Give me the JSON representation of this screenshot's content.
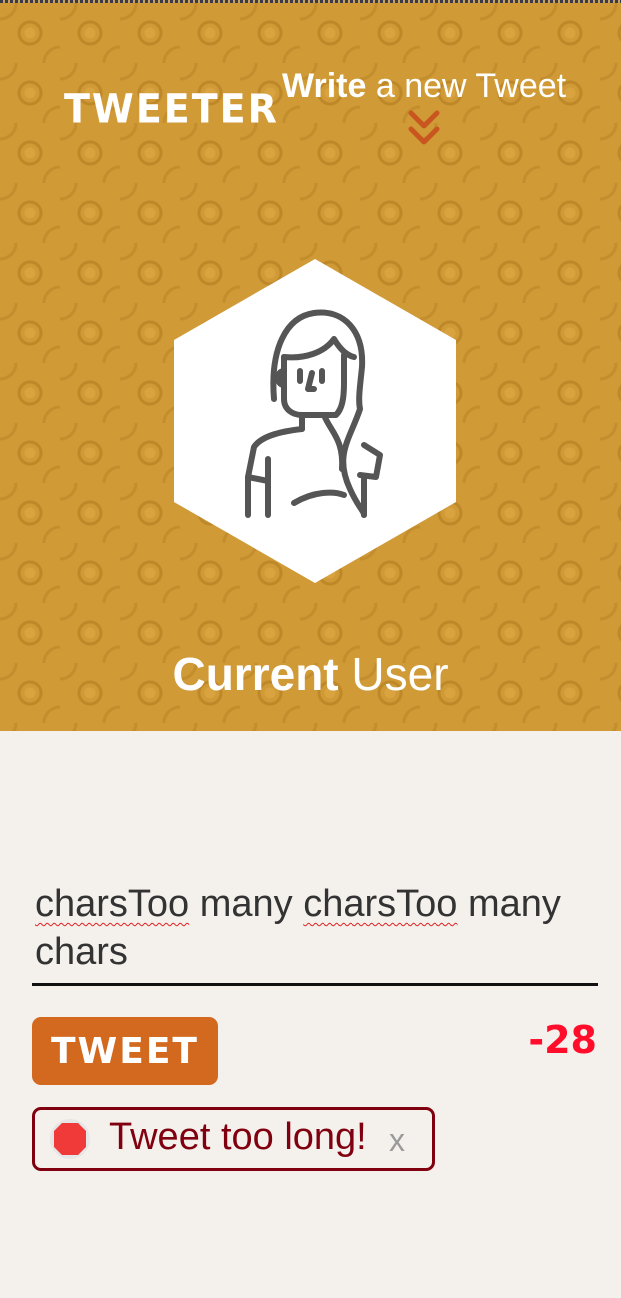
{
  "app": {
    "brand": "TWEETER"
  },
  "nav": {
    "write_bold": "Write",
    "write_rest": " a new Tweet",
    "chevron_icon": "double-chevron-down-icon"
  },
  "profile": {
    "avatar_icon": "user-avatar-icon",
    "name_bold": "Current",
    "name_rest": " User"
  },
  "composer": {
    "text_parts": [
      "charsToo",
      " many ",
      "charsToo",
      " many",
      "chars"
    ]
  },
  "actions": {
    "tweet_label": "TWEET",
    "char_counter": "-28"
  },
  "alert": {
    "icon": "stop-sign-icon",
    "message": "Tweet too long!",
    "close_label": "x"
  },
  "colors": {
    "hero_background": "#d09a36",
    "accent_button": "#d2691e",
    "counter_over_limit": "#ff0d2a",
    "alert_border": "#800010",
    "page_background": "#f4f1ed"
  }
}
